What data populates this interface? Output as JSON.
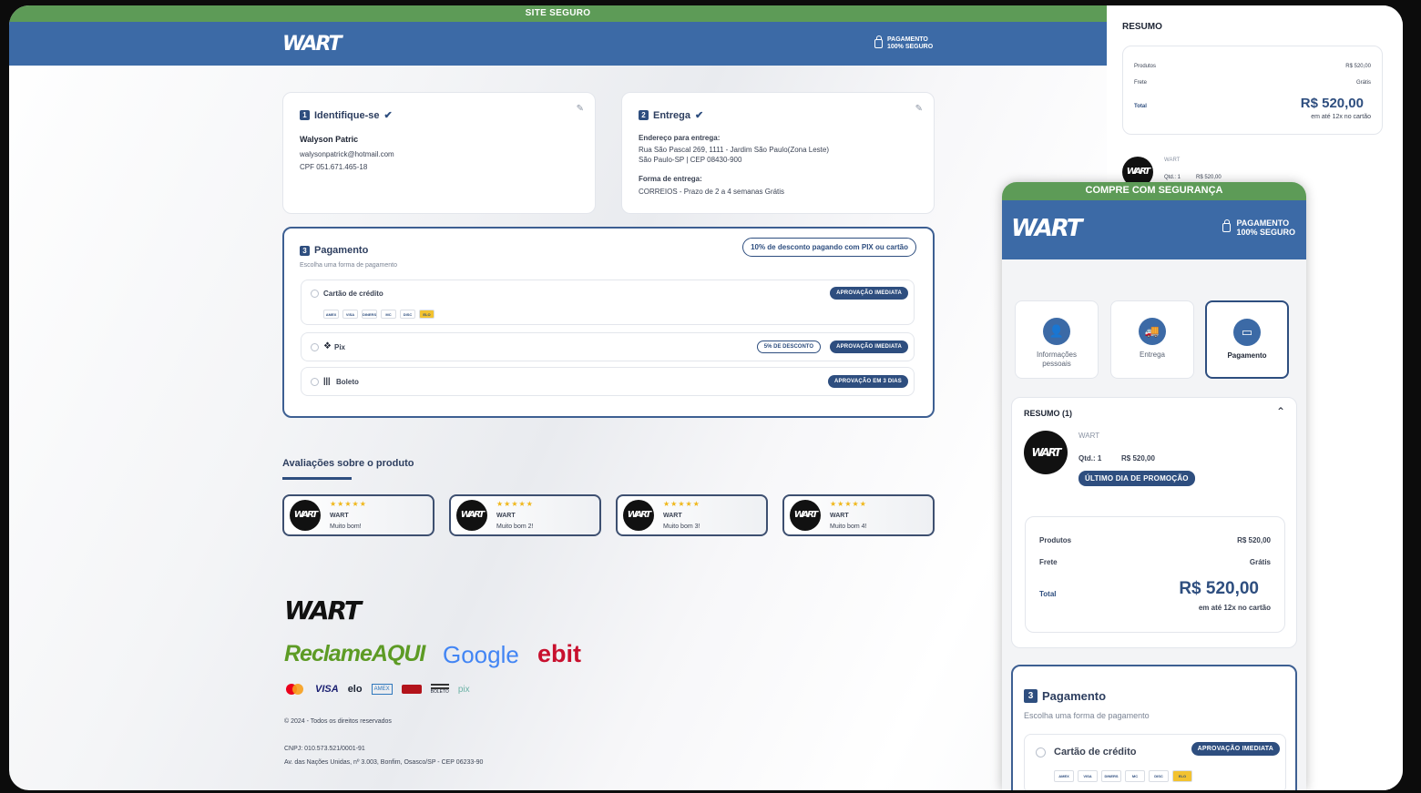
{
  "header": {
    "site_secure": "SITE SEGURO",
    "logo": "WART",
    "pay_secure_1": "PAGAMENTO",
    "pay_secure_2": "100% SEGURO"
  },
  "identify": {
    "num": "1",
    "title": "Identifique-se",
    "name": "Walyson Patric",
    "email": "walysonpatrick@hotmail.com",
    "cpf": "CPF 051.671.465-18"
  },
  "delivery": {
    "num": "2",
    "title": "Entrega",
    "addr_label": "Endereço para entrega:",
    "addr_line1": "Rua São Pascal 269, 1111 - Jardim São Paulo(Zona Leste)",
    "addr_line2": "São Paulo-SP | CEP 08430-900",
    "method_label": "Forma de entrega:",
    "method": "CORREIOS - Prazo de 2 a 4 semanas Grátis"
  },
  "payment": {
    "num": "3",
    "title": "Pagamento",
    "subtitle": "Escolha uma forma de pagamento",
    "discount_badge": "10% de desconto pagando com PIX ou cartão",
    "credit_label": "Cartão de crédito",
    "credit_badge": "APROVAÇÃO IMEDIATA",
    "pix_label": "Pix",
    "pix_discount": "5% DE DESCONTO",
    "pix_badge": "APROVAÇÃO IMEDIATA",
    "boleto_label": "Boleto",
    "boleto_badge": "APROVAÇÃO EM 3 DIAS",
    "cards": [
      "AMEX",
      "VISA",
      "DINERS",
      "MC",
      "DISC",
      "ELO"
    ]
  },
  "reviews": {
    "title": "Avaliações sobre o produto",
    "stars": "★★★★★",
    "items": [
      {
        "author": "WART",
        "text": "Muito bom!"
      },
      {
        "author": "WART",
        "text": "Muito bom 2!"
      },
      {
        "author": "WART",
        "text": "Muito bom 3!"
      },
      {
        "author": "WART",
        "text": "Muito bom 4!"
      }
    ]
  },
  "footer": {
    "logo": "WART",
    "reclame": "ReclameAQUI",
    "google": "Google",
    "ebit": "ebit",
    "pay_icons": [
      "VISA",
      "elo",
      "AMEX",
      "BOLETO",
      "pix"
    ],
    "copyright": "© 2024 - Todos os direitos reservados",
    "cnpj": "CNPJ: 010.573.521/0001-91",
    "address": "Av. das Nações Unidas, nº 3.003, Bonfim, Osasco/SP - CEP 06233-90"
  },
  "summary": {
    "title": "RESUMO",
    "products_label": "Produtos",
    "products_value": "R$ 520,00",
    "shipping_label": "Frete",
    "shipping_value": "Grátis",
    "total_label": "Total",
    "total_value": "R$ 520,00",
    "installments": "em até 12x no cartão",
    "item_brand": "WART",
    "item_qty": "Qtd.: 1",
    "item_price": "R$ 520,00"
  },
  "mobile": {
    "secure_bar": "COMPRE COM SEGURANÇA",
    "steps": [
      "Informações pessoais",
      "Entrega",
      "Pagamento"
    ],
    "resumo_title": "RESUMO (1)",
    "promo": "ÚLTIMO DIA DE PROMOÇÃO"
  }
}
